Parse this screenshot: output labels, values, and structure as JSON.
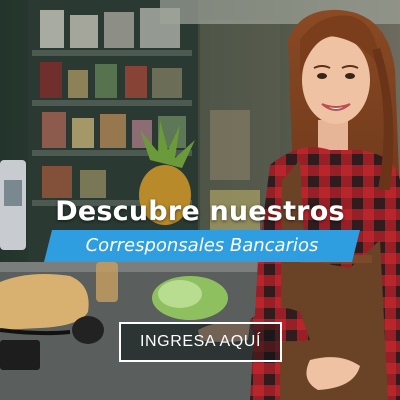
{
  "banner": {
    "headline": "Descubre nuestros",
    "subheadline": "Corresponsales Bancarios",
    "cta_label": "INGRESA AQUÍ"
  },
  "colors": {
    "accent_blue": "#2e9ee0",
    "text_white": "#ffffff",
    "shirt_red": "#b8262c"
  }
}
